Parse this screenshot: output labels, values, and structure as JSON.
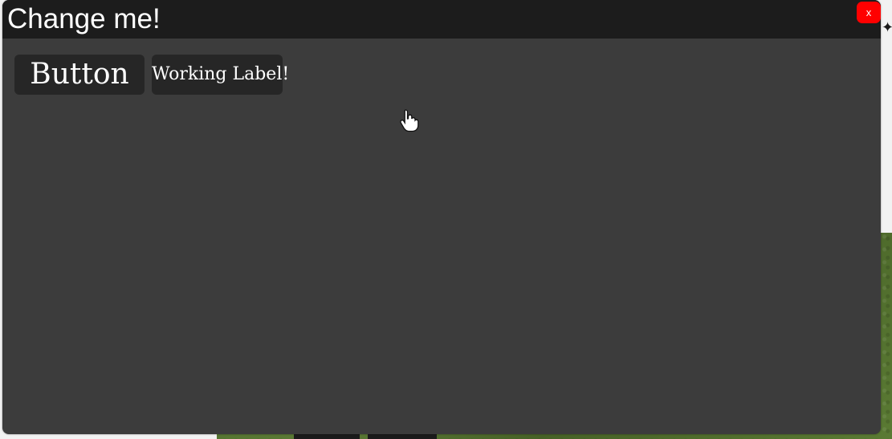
{
  "window": {
    "title": "Change me!",
    "close_label": "x"
  },
  "controls": {
    "button_label": "Button",
    "working_label": "Working Label!"
  },
  "icons": {
    "cursor": "hand-pointer-icon",
    "edge_object": "figure-icon"
  },
  "colors": {
    "window_bg": "#3c3c3c",
    "titlebar_bg": "#1c1c1c",
    "button_bg": "#262626",
    "close_bg": "#ff0000",
    "grass": "#5b7a35"
  }
}
